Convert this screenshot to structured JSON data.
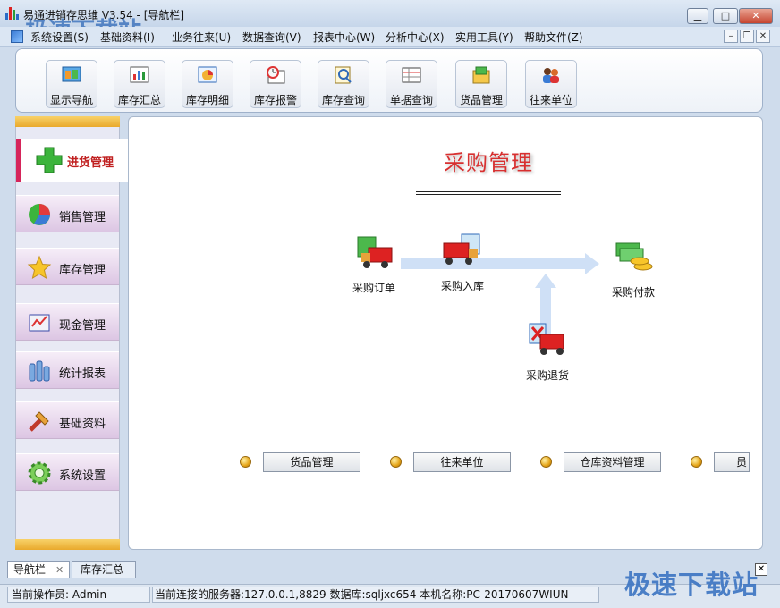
{
  "window": {
    "title": "易通进销存思维 V3.54 - [导航栏]",
    "watermark_top": "极速下载站",
    "min_label": "▭",
    "restore_label": "▣",
    "close_label": "✕"
  },
  "menu": [
    {
      "label": "系统设置(S)"
    },
    {
      "label": "基础资料(I)"
    },
    {
      "label": "业务往来(U)"
    },
    {
      "label": "数据查询(V)"
    },
    {
      "label": "报表中心(W)"
    },
    {
      "label": "分析中心(X)"
    },
    {
      "label": "实用工具(Y)"
    },
    {
      "label": "帮助文件(Z)"
    }
  ],
  "toolbar": [
    {
      "label": "显示导航",
      "icon": "navigation-icon"
    },
    {
      "label": "库存汇总",
      "icon": "inventory-summary-icon"
    },
    {
      "label": "库存明细",
      "icon": "inventory-detail-icon"
    },
    {
      "label": "库存报警",
      "icon": "inventory-alarm-icon"
    },
    {
      "label": "库存查询",
      "icon": "inventory-query-icon"
    },
    {
      "label": "单据查询",
      "icon": "document-query-icon"
    },
    {
      "label": "货品管理",
      "icon": "goods-icon"
    },
    {
      "label": "往来单位",
      "icon": "contacts-icon"
    }
  ],
  "nav": {
    "active": {
      "label": "进货管理",
      "icon": "plus-icon"
    },
    "items": [
      {
        "label": "销售管理",
        "icon": "pie-chart-icon"
      },
      {
        "label": "库存管理",
        "icon": "star-icon"
      },
      {
        "label": "现金管理",
        "icon": "cash-icon"
      },
      {
        "label": "统计报表",
        "icon": "bar-stats-icon"
      },
      {
        "label": "基础资料",
        "icon": "tools-icon"
      },
      {
        "label": "系统设置",
        "icon": "gear-icon"
      }
    ]
  },
  "main": {
    "title": "采购管理",
    "flow": {
      "order": "采购订单",
      "inbound": "采购入库",
      "payment": "采购付款",
      "return": "采购退货"
    },
    "buttons": [
      {
        "label": "货品管理"
      },
      {
        "label": "往来单位"
      },
      {
        "label": "仓库资料管理"
      },
      {
        "label": "员"
      }
    ]
  },
  "tabs": [
    {
      "label": "导航栏",
      "close": "✕"
    },
    {
      "label": "库存汇总"
    }
  ],
  "tab_close_all": "✕",
  "status": {
    "operator": "当前操作员: Admin",
    "server": "当前连接的服务器:127.0.0.1,8829 数据库:sqljxc654 本机名称:PC-20170607WIUN"
  },
  "watermark": "极速下载站",
  "colors": {
    "title_red": "#d83030",
    "nav_accent": "#d6245a",
    "panel_bar": "#e9a92c"
  }
}
